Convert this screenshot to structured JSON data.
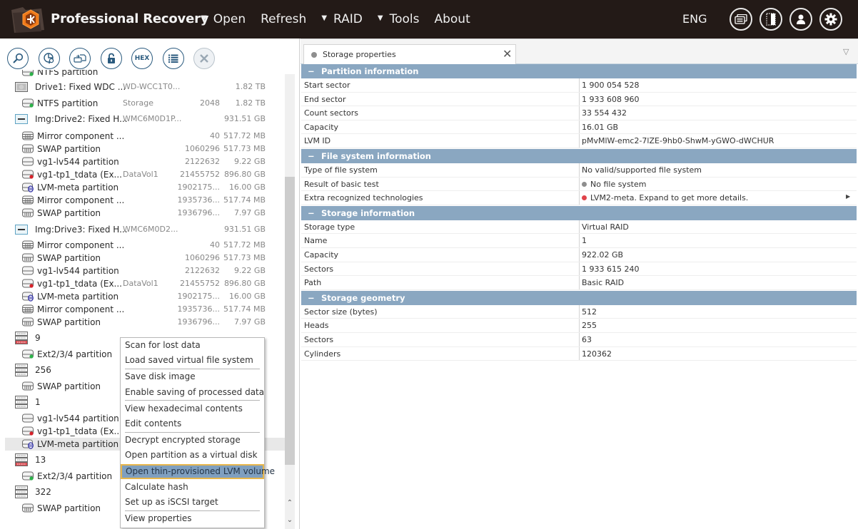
{
  "app": {
    "title": "Professional Recovery",
    "menu": [
      {
        "label": "Open",
        "has_dropdown": true
      },
      {
        "label": "Refresh",
        "has_dropdown": false
      },
      {
        "label": "RAID",
        "has_dropdown": true
      },
      {
        "label": "Tools",
        "has_dropdown": true
      },
      {
        "label": "About",
        "has_dropdown": false
      }
    ],
    "language": "ENG",
    "header_icons": [
      "messages-icon",
      "panel-toggle-icon",
      "user-icon",
      "settings-gear-icon"
    ],
    "menu_arrow": "▼"
  },
  "toolbar": {
    "buttons": [
      {
        "name": "scan-button",
        "icon": "magnifier-icon"
      },
      {
        "name": "search-files-button",
        "icon": "pie-search-icon"
      },
      {
        "name": "save-image-button",
        "icon": "disk-image-icon"
      },
      {
        "name": "decrypt-button",
        "icon": "padlock-icon"
      },
      {
        "name": "hex-button",
        "icon": "hex-icon",
        "text": "HEX"
      },
      {
        "name": "properties-button",
        "icon": "list-icon"
      },
      {
        "name": "close-storage-button",
        "icon": "close-icon",
        "disabled": true
      }
    ]
  },
  "tree": {
    "rows": [
      {
        "level": 1,
        "icon": "partition-green",
        "name": "NTFS partition",
        "label": "",
        "start": "",
        "size": "",
        "partial": true
      },
      {
        "level": 0,
        "icon": "hdd",
        "name": "Drive1: Fixed WDC ...",
        "label": "WD-WCC1T0...",
        "start": "",
        "size": "1.82 TB"
      },
      {
        "level": 1,
        "icon": "partition-green",
        "name": "NTFS partition",
        "label": "Storage",
        "start": "2048",
        "size": "1.82 TB"
      },
      {
        "level": 0,
        "icon": "image-drive",
        "name": "Img:Drive2: Fixed H...",
        "label": "WMC6M0D1P...",
        "start": "",
        "size": "931.51 GB"
      },
      {
        "level": 1,
        "icon": "mirror",
        "name": "Mirror component ...",
        "label": "",
        "start": "40",
        "size": "517.72 MB"
      },
      {
        "level": 1,
        "icon": "swap",
        "name": "SWAP partition",
        "label": "",
        "start": "1060296",
        "size": "517.73 MB"
      },
      {
        "level": 1,
        "icon": "partition",
        "name": "vg1-lv544 partition",
        "label": "",
        "start": "2122632",
        "size": "9.22 GB"
      },
      {
        "level": 1,
        "icon": "partition-red",
        "name": "vg1-tp1_tdata (Ex...",
        "label": "DataVol1",
        "start": "21455752",
        "size": "896.80 GB"
      },
      {
        "level": 1,
        "icon": "lvm-meta",
        "name": "LVM-meta partition",
        "label": "",
        "start": "1902175...",
        "size": "16.00 GB"
      },
      {
        "level": 1,
        "icon": "mirror",
        "name": "Mirror component ...",
        "label": "",
        "start": "1935736...",
        "size": "517.74 MB"
      },
      {
        "level": 1,
        "icon": "swap",
        "name": "SWAP partition",
        "label": "",
        "start": "1936796...",
        "size": "7.97 GB"
      },
      {
        "level": 0,
        "icon": "image-drive",
        "name": "Img:Drive3: Fixed H...",
        "label": "WMC6M0D2...",
        "start": "",
        "size": "931.51 GB"
      },
      {
        "level": 1,
        "icon": "mirror",
        "name": "Mirror component ...",
        "label": "",
        "start": "40",
        "size": "517.72 MB"
      },
      {
        "level": 1,
        "icon": "swap",
        "name": "SWAP partition",
        "label": "",
        "start": "1060296",
        "size": "517.73 MB"
      },
      {
        "level": 1,
        "icon": "partition",
        "name": "vg1-lv544 partition",
        "label": "",
        "start": "2122632",
        "size": "9.22 GB"
      },
      {
        "level": 1,
        "icon": "partition-red",
        "name": "vg1-tp1_tdata (Ex...",
        "label": "DataVol1",
        "start": "21455752",
        "size": "896.80 GB"
      },
      {
        "level": 1,
        "icon": "lvm-meta",
        "name": "LVM-meta partition",
        "label": "",
        "start": "1902175...",
        "size": "16.00 GB"
      },
      {
        "level": 1,
        "icon": "mirror",
        "name": "Mirror component ...",
        "label": "",
        "start": "1935736...",
        "size": "517.74 MB"
      },
      {
        "level": 1,
        "icon": "swap",
        "name": "SWAP partition",
        "label": "",
        "start": "1936796...",
        "size": "7.97 GB"
      },
      {
        "level": 0,
        "icon": "raid-red",
        "name": "9",
        "label": "",
        "start": "",
        "size": ""
      },
      {
        "level": 1,
        "icon": "partition-green",
        "name": "Ext2/3/4 partition",
        "label": "",
        "start": "",
        "size": ""
      },
      {
        "level": 0,
        "icon": "raid",
        "name": "256",
        "label": "",
        "start": "",
        "size": ""
      },
      {
        "level": 1,
        "icon": "swap",
        "name": "SWAP partition",
        "label": "",
        "start": "",
        "size": ""
      },
      {
        "level": 0,
        "icon": "raid",
        "name": "1",
        "label": "",
        "start": "",
        "size": ""
      },
      {
        "level": 1,
        "icon": "partition",
        "name": "vg1-lv544 partition",
        "label": "",
        "start": "",
        "size": ""
      },
      {
        "level": 1,
        "icon": "partition-red",
        "name": "vg1-tp1_tdata (Ex...",
        "label": "",
        "start": "",
        "size": ""
      },
      {
        "level": 1,
        "icon": "lvm-meta",
        "name": "LVM-meta partition",
        "label": "",
        "start": "",
        "size": "",
        "selected": true
      },
      {
        "level": 0,
        "icon": "raid-red",
        "name": "13",
        "label": "",
        "start": "",
        "size": ""
      },
      {
        "level": 1,
        "icon": "partition-green",
        "name": "Ext2/3/4 partition",
        "label": "",
        "start": "",
        "size": ""
      },
      {
        "level": 0,
        "icon": "raid",
        "name": "322",
        "label": "",
        "start": "",
        "size": ""
      },
      {
        "level": 1,
        "icon": "swap",
        "name": "SWAP partition",
        "label": "",
        "start": "",
        "size": ""
      }
    ]
  },
  "context_menu": {
    "groups": [
      [
        "Scan for lost data",
        "Load saved virtual file system"
      ],
      [
        "Save disk image",
        "Enable saving of processed data"
      ],
      [
        "View hexadecimal contents",
        "Edit contents"
      ],
      [
        "Decrypt encrypted storage",
        "Open partition as a virtual disk",
        "Open thin-provisioned LVM volume",
        "Calculate hash",
        "Set up as iSCSI target"
      ],
      [
        "View properties"
      ]
    ],
    "highlighted": "Open thin-provisioned LVM volume"
  },
  "properties": {
    "tab_label": "Storage properties",
    "sections": [
      {
        "title": "Partition information",
        "rows": [
          {
            "key": "Start sector",
            "value": "1 900 054 528"
          },
          {
            "key": "End sector",
            "value": "1 933 608 960"
          },
          {
            "key": "Count sectors",
            "value": "33 554 432"
          },
          {
            "key": "Capacity",
            "value": "16.01 GB"
          },
          {
            "key": "LVM ID",
            "value": "pMvMlW-emc2-7lZE-9hb0-ShwM-yGWO-dWCHUR"
          }
        ]
      },
      {
        "title": "File system information",
        "rows": [
          {
            "key": "Type of file system",
            "value": "No valid/supported file system"
          },
          {
            "key": "Result of basic test",
            "value": "No file system",
            "status_color": "#8e8e8e"
          },
          {
            "key": "Extra recognized technologies",
            "value": "LVM2-meta. Expand to get more details.",
            "status_color": "#e0434a",
            "expandable": true
          }
        ]
      },
      {
        "title": "Storage information",
        "rows": [
          {
            "key": "Storage type",
            "value": "Virtual RAID"
          },
          {
            "key": "Name",
            "value": "1"
          },
          {
            "key": "Capacity",
            "value": "922.02 GB"
          },
          {
            "key": "Sectors",
            "value": "1 933 615 240"
          },
          {
            "key": "Path",
            "value": "Basic RAID"
          }
        ]
      },
      {
        "title": "Storage geometry",
        "rows": [
          {
            "key": "Sector size (bytes)",
            "value": "512"
          },
          {
            "key": "Heads",
            "value": "255"
          },
          {
            "key": "Sectors",
            "value": "63"
          },
          {
            "key": "Cylinders",
            "value": "120362"
          }
        ]
      }
    ]
  },
  "colors": {
    "topbar": "#231a17",
    "accent": "#f07a1a",
    "section_header": "#8aa7c1",
    "menu_highlight": "#7f9fbf",
    "menu_highlight_border": "#e7b64c",
    "toolbar_icon": "#2a5a7e"
  }
}
